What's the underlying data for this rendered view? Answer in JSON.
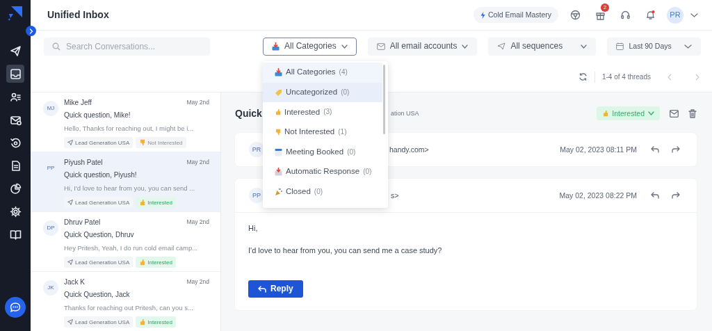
{
  "sidebar": {
    "nav_items": [
      {
        "selected": false
      },
      {
        "selected": true
      },
      {
        "selected": false
      },
      {
        "selected": false
      },
      {
        "selected": false
      },
      {
        "selected": false
      },
      {
        "selected": false
      },
      {
        "selected": false
      },
      {
        "selected": false
      }
    ]
  },
  "header": {
    "title": "Unified Inbox",
    "promo": "Cold Email Mastery",
    "gift_badge": "2",
    "avatar": "PR"
  },
  "filters": {
    "search": {
      "placeholder": "Search Conversations..."
    },
    "category": {
      "label": "All Categories",
      "open": true
    },
    "accounts": "All email accounts",
    "sequences": "All sequences",
    "date_range": "Last 90 Days"
  },
  "toolbar": {
    "thread_count": "1-4 of 4 threads"
  },
  "conversations": [
    {
      "initials": "MJ",
      "name": "Mike Jeff",
      "date": "May 2nd",
      "subject": "Quick question, Mike!",
      "preview": "Hello, Thanks for reaching out, I might be i...",
      "sequence": "Lead Generation USA",
      "category": {
        "label": "Not Interested",
        "kind": "not_interested"
      },
      "selected": false
    },
    {
      "initials": "PP",
      "name": "Piyush Patel",
      "date": "May 2nd",
      "subject": "Quick question, Piyush!",
      "preview": "Hi, I'd love to hear from you, you can send ...",
      "sequence": "Lead Generation USA",
      "category": {
        "label": "Interested",
        "kind": "interested"
      },
      "selected": true
    },
    {
      "initials": "DP",
      "name": "Dhruv Patel",
      "date": "May 2nd",
      "subject": "Quick Question, Dhruv",
      "preview": "Hey Pritesh, Yeah, I do run cold email camp...",
      "sequence": "Lead Generation USA",
      "category": {
        "label": "Interested",
        "kind": "interested"
      },
      "selected": false
    },
    {
      "initials": "JK",
      "name": "Jack K",
      "date": "May 2nd",
      "subject": "Quick Question, Jack",
      "preview": "Thanks for reaching out Pritesh, can you s...",
      "sequence": "Lead Generation USA",
      "category": {
        "label": "Interested",
        "kind": "interested"
      },
      "selected": false
    }
  ],
  "thread": {
    "subject": "Quick",
    "sequence": "ation USA",
    "status": {
      "label": "Interested",
      "kind": "interested"
    },
    "messages": [
      {
        "initials": "PR",
        "sender": "handy.com>",
        "date": "May 02, 2023 08:11 PM",
        "expanded": false
      },
      {
        "initials": "PP",
        "sender": "s>",
        "date": "May 02, 2023 08:22 PM",
        "expanded": true,
        "body": [
          "Hi,",
          "I'd love to hear from you, you can send me a case study?"
        ],
        "reply": "Reply"
      }
    ]
  },
  "category_menu": {
    "items": [
      {
        "kind": "all",
        "label": "All Categories",
        "count": "(4)",
        "selected": true,
        "hovered": false
      },
      {
        "kind": "uncategorized",
        "label": "Uncategorized",
        "count": "(0)",
        "selected": false,
        "hovered": true
      },
      {
        "kind": "interested",
        "label": "Interested",
        "count": "(3)",
        "selected": false,
        "hovered": false
      },
      {
        "kind": "not_interested",
        "label": "Not Interested",
        "count": "(1)",
        "selected": false,
        "hovered": false
      },
      {
        "kind": "meeting",
        "label": "Meeting Booked",
        "count": "(0)",
        "selected": false,
        "hovered": false
      },
      {
        "kind": "auto",
        "label": "Automatic Response",
        "count": "(0)",
        "selected": false,
        "hovered": false
      },
      {
        "kind": "closed",
        "label": "Closed",
        "count": "(0)",
        "selected": false,
        "hovered": false
      }
    ]
  }
}
